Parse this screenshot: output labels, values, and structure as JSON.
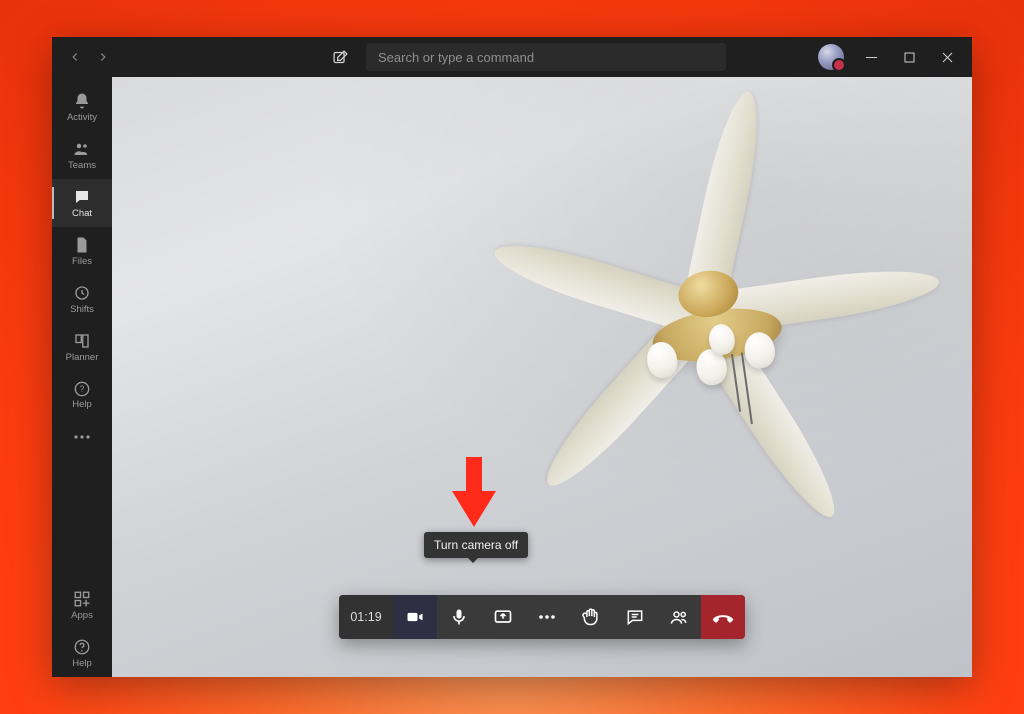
{
  "titlebar": {
    "search_placeholder": "Search or type a command"
  },
  "rail": {
    "items": [
      {
        "label": "Activity"
      },
      {
        "label": "Teams"
      },
      {
        "label": "Chat"
      },
      {
        "label": "Files"
      },
      {
        "label": "Shifts"
      },
      {
        "label": "Planner"
      },
      {
        "label": "Help"
      }
    ],
    "bottom": [
      {
        "label": "Apps"
      },
      {
        "label": "Help"
      }
    ]
  },
  "call": {
    "duration": "01:19",
    "tooltip": "Turn camera off"
  }
}
